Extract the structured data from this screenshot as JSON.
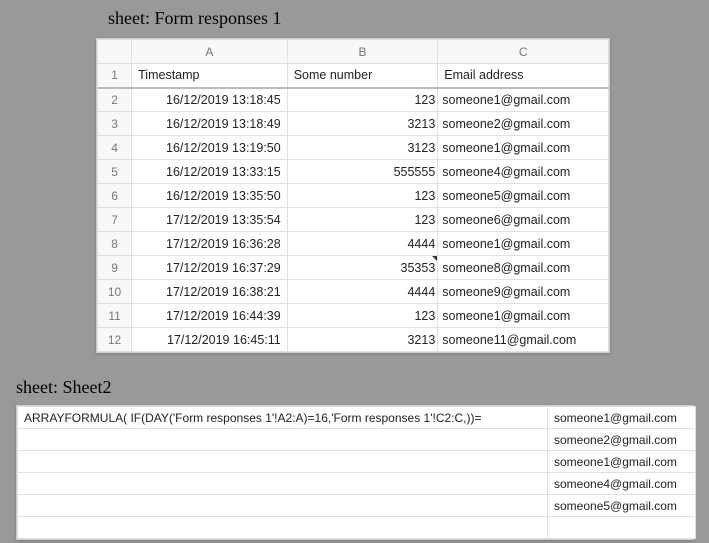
{
  "labels": {
    "sheet1": "sheet: Form responses 1",
    "sheet2": "sheet: Sheet2"
  },
  "sheet1": {
    "columns": [
      "A",
      "B",
      "C"
    ],
    "headers": {
      "timestamp": "Timestamp",
      "number": "Some number",
      "email": "Email address"
    },
    "rows": [
      {
        "n": "2",
        "ts": "16/12/2019 13:18:45",
        "num": "123",
        "em": "someone1@gmail.com"
      },
      {
        "n": "3",
        "ts": "16/12/2019 13:18:49",
        "num": "3213",
        "em": "someone2@gmail.com"
      },
      {
        "n": "4",
        "ts": "16/12/2019 13:19:50",
        "num": "3123",
        "em": "someone1@gmail.com"
      },
      {
        "n": "5",
        "ts": "16/12/2019 13:33:15",
        "num": "555555",
        "em": "someone4@gmail.com"
      },
      {
        "n": "6",
        "ts": "16/12/2019 13:35:50",
        "num": "123",
        "em": "someone5@gmail.com"
      },
      {
        "n": "7",
        "ts": "17/12/2019 13:35:54",
        "num": "123",
        "em": "someone6@gmail.com"
      },
      {
        "n": "8",
        "ts": "17/12/2019 16:36:28",
        "num": "4444",
        "em": "someone1@gmail.com"
      },
      {
        "n": "9",
        "ts": "17/12/2019 16:37:29",
        "num": "35353",
        "em": "someone8@gmail.com"
      },
      {
        "n": "10",
        "ts": "17/12/2019 16:38:21",
        "num": "4444",
        "em": "someone9@gmail.com"
      },
      {
        "n": "11",
        "ts": "17/12/2019 16:44:39",
        "num": "123",
        "em": "someone1@gmail.com"
      },
      {
        "n": "12",
        "ts": "17/12/2019 16:45:11",
        "num": "3213",
        "em": "someone11@gmail.com"
      }
    ]
  },
  "sheet2": {
    "formula": "ARRAYFORMULA( IF(DAY('Form responses 1'!A2:A)=16,'Form responses 1'!C2:C,))=",
    "results": [
      "someone1@gmail.com",
      "someone2@gmail.com",
      "someone1@gmail.com",
      "someone4@gmail.com",
      "someone5@gmail.com"
    ]
  }
}
